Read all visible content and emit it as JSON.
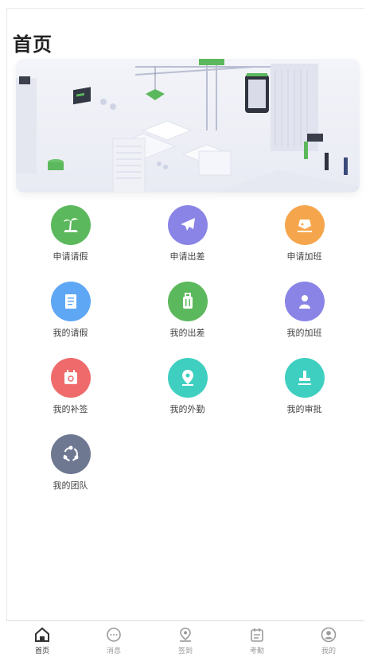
{
  "page": {
    "title": "首页"
  },
  "colors": {
    "green": "#5cb85c",
    "purple": "#8a84e6",
    "orange": "#f5a64d",
    "blue": "#5ea7f5",
    "red": "#ef6b6b",
    "teal": "#3fcfc0",
    "gray": "#6f7891"
  },
  "menu": [
    {
      "label": "申请请假",
      "icon": "beach-icon"
    },
    {
      "label": "申请出差",
      "icon": "airplane-icon"
    },
    {
      "label": "申请加班",
      "icon": "overtime-icon"
    },
    {
      "label": "我的请假",
      "icon": "document-icon"
    },
    {
      "label": "我的出差",
      "icon": "suitcase-icon"
    },
    {
      "label": "我的加班",
      "icon": "person-icon"
    },
    {
      "label": "我的补签",
      "icon": "calendar-icon"
    },
    {
      "label": "我的外勤",
      "icon": "location-icon"
    },
    {
      "label": "我的审批",
      "icon": "stamp-icon"
    },
    {
      "label": "我的团队",
      "icon": "team-icon"
    }
  ],
  "tabbar": [
    {
      "label": "首页",
      "icon": "home-icon",
      "active": true
    },
    {
      "label": "消息",
      "icon": "message-icon"
    },
    {
      "label": "签到",
      "icon": "checkin-icon"
    },
    {
      "label": "考勤",
      "icon": "attendance-icon"
    },
    {
      "label": "我的",
      "icon": "profile-icon"
    }
  ]
}
